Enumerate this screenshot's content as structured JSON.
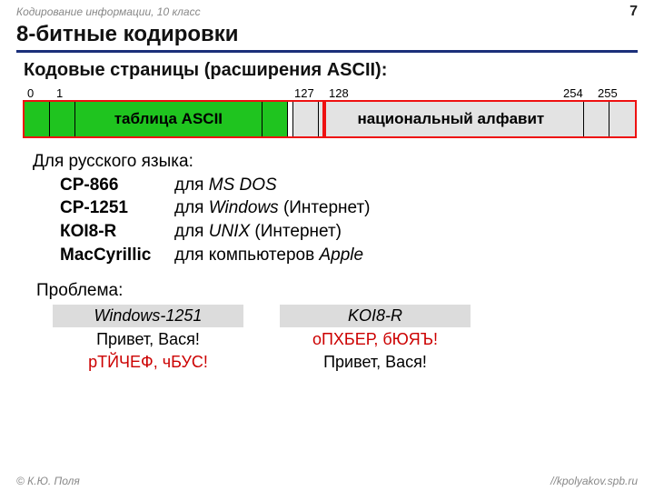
{
  "header": {
    "course": "Кодирование информации, 10 класс",
    "page": "7"
  },
  "title": "8-битные кодировки",
  "subtitle": "Кодовые страницы (расширения ASCII):",
  "bar": {
    "labels": {
      "l0": "0",
      "l1": "1",
      "l127": "127",
      "l128": "128",
      "l254": "254",
      "l255": "255"
    },
    "left_label": "таблица ASCII",
    "right_label": "национальный алфавит"
  },
  "rus_intro": "Для русского языка:",
  "encodings": [
    {
      "name": "CP-866",
      "pre": "для ",
      "it": "MS DOS",
      "post": ""
    },
    {
      "name": "CP-1251",
      "pre": "для ",
      "it": "Windows",
      "post": " (Интернет)"
    },
    {
      "name": "КОI8-R",
      "pre": "для ",
      "it": "UNIX",
      "post": " (Интернет)"
    },
    {
      "name": "MacCyrillic",
      "pre": "для компьютеров ",
      "it": "Apple",
      "post": ""
    }
  ],
  "problem_label": "Проблема:",
  "table": {
    "h1": "Windows-1251",
    "h2": "KOI8-R",
    "r1c1": "Привет, Вася!",
    "r1c2": "оПХБЕР, бЮЯЪ!",
    "r2c1": "рТЙЧЕФ, чБУС!",
    "r2c2": "Привет, Вася!"
  },
  "footer": {
    "left": "© К.Ю. Поля",
    "right": "//kpolyakov.spb.ru"
  }
}
